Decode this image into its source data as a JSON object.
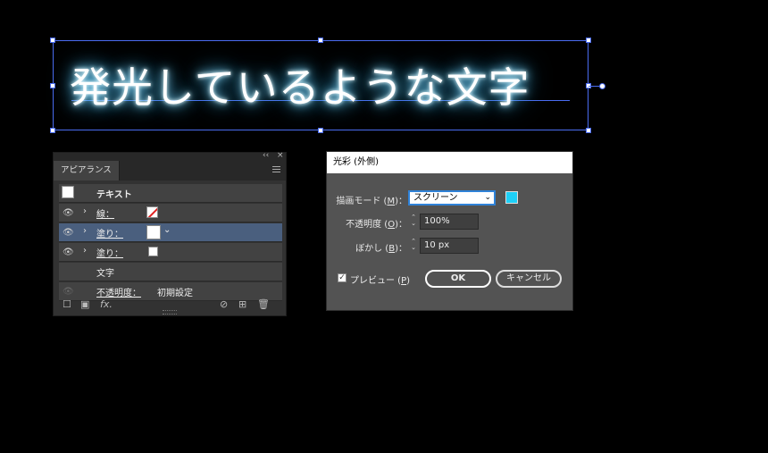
{
  "canvas": {
    "text": "発光しているような文字",
    "glow_color": "#46b8e8",
    "selection_color": "#4a6cf0"
  },
  "appearance_panel": {
    "tab_label": "アピアランス",
    "collapse_glyph": "‹‹",
    "close_glyph": "×",
    "object_label": "テキスト",
    "rows": [
      {
        "label": "線：",
        "swatch": "none-stroke"
      },
      {
        "label": "塗り：",
        "swatch": "#ffffff",
        "selected": true
      },
      {
        "label": "塗り：",
        "swatch": "#ffffff"
      },
      {
        "label": "文字"
      },
      {
        "label": "不透明度：",
        "value": "初期設定"
      }
    ],
    "expand_glyph": "›",
    "fx_label": "fx."
  },
  "outer_glow_dialog": {
    "title": "光彩 (外側)",
    "mode_label": "描画モード",
    "mode_key": "M",
    "mode_value": "スクリーン",
    "glow_color": "#1ed0f8",
    "opacity_label": "不透明度",
    "opacity_key": "O",
    "opacity_value": "100%",
    "blur_label": "ぼかし",
    "blur_key": "B",
    "blur_value": "10 px",
    "preview_label": "プレビュー",
    "preview_key": "P",
    "preview_checked": true,
    "ok_label": "OK",
    "cancel_label": "キャンセル"
  }
}
